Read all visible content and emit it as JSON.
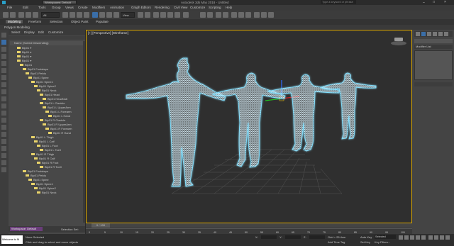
{
  "titlebar": {
    "workspace": "Workspaces: Default",
    "title": "Autodesk 3ds Max 2018 - Untitled",
    "search_placeholder": "Type a keyword or phrase"
  },
  "menu": {
    "items": [
      "File",
      "Edit",
      "Tools",
      "Group",
      "Views",
      "Create",
      "Modifiers",
      "Animation",
      "Graph Editors",
      "Rendering",
      "Civil View",
      "Customize",
      "Scripting",
      "Help"
    ]
  },
  "toolbar": {
    "selection_filter": "All",
    "view_dropdown": "View"
  },
  "ribbon": {
    "tabs": [
      "Modeling",
      "Freeform",
      "Selection",
      "Object Paint",
      "Populate"
    ],
    "sub_label": "Polygon Modeling"
  },
  "scene_explorer": {
    "tabs": [
      "Select",
      "Display",
      "Edit",
      "Customize"
    ],
    "header": "Name (Sorted Descending)",
    "rows": [
      "Bip01 ▾",
      "Bip01 ▾",
      "Bip01 ▾",
      "Bip01 ▾",
      "Bip01",
      "Bip01 Footsteps",
      "Bip01 Pelvis",
      "Bip01 Spine",
      "Bip01 Spine1",
      "Bip01 Spine2",
      "Bip01 Neck",
      "Bip01 Head",
      "Bip01 HeadNub",
      "Bip01 L Clavicle",
      "Bip01 L UpperArm",
      "Bip01 L Forearm",
      "Bip01 L Hand",
      "Bip01 R Clavicle",
      "Bip01 R UpperArm",
      "Bip01 R Forearm",
      "Bip01 R Hand",
      "Bip01 L Thigh",
      "Bip01 L Calf",
      "Bip01 L Foot",
      "Bip01 L Toe0",
      "Bip01 R Thigh",
      "Bip01 R Calf",
      "Bip01 R Foot",
      "Bip01 R Toe0",
      "Bip01 Footsteps",
      "Bip01 Pelvis",
      "Bip01 Spine",
      "Bip01 Spine1",
      "Bip01 Spine2",
      "Bip01 Neck"
    ],
    "workspace_dropdown": "Workspace: Default",
    "selection_set_label": "Selection Set:"
  },
  "viewport": {
    "label": "[+] [Perspective] [Wireframe]"
  },
  "modifier_panel": {
    "modifier_list": "Modifier List"
  },
  "timeline": {
    "frame_display": "0 / 100",
    "ticks": [
      "0",
      "5",
      "10",
      "15",
      "20",
      "25",
      "30",
      "35",
      "40",
      "45",
      "50",
      "55",
      "60",
      "65",
      "70",
      "75",
      "80",
      "85",
      "90",
      "95",
      "100"
    ]
  },
  "status": {
    "maxscript": "Welcome to M",
    "objects_selected": "None Selected",
    "prompt": "Click and drag to select and move objects",
    "x_label": "X:",
    "y_label": "Y:",
    "z_label": "Z:",
    "grid": "Grid = 25.4cm",
    "add_time_tag": "Add Time Tag",
    "auto_key": "Auto Key",
    "selected": "Selected",
    "set_key": "Set Key",
    "key_filters": "Key Filters..."
  },
  "colors": {
    "viewport_border": "#d8a500",
    "mesh": "#ffffff",
    "mesh_glow": "#5fd8ff",
    "grid": "#555555"
  }
}
